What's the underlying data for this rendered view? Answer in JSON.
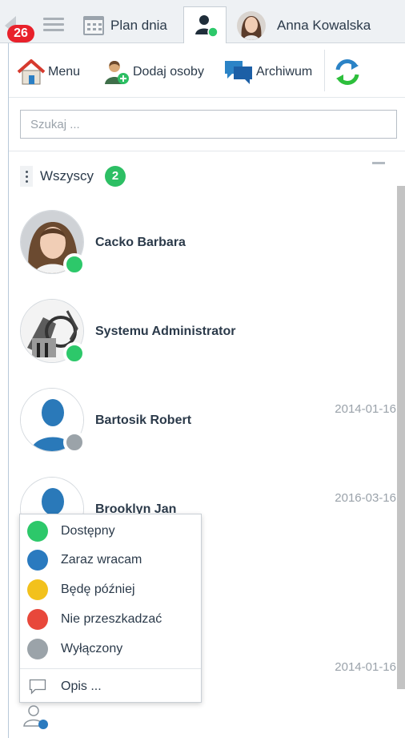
{
  "tabs": {
    "badge_count": "26",
    "plan_label": "Plan dnia",
    "user_name": "Anna Kowalska"
  },
  "toolbar": {
    "menu_label": "Menu",
    "add_people_label": "Dodaj osoby",
    "archive_label": "Archiwum"
  },
  "search": {
    "value": "",
    "placeholder": "Szukaj ..."
  },
  "group": {
    "name": "Wszyscy",
    "count": "2"
  },
  "contacts": [
    {
      "name": "Cacko Barbara",
      "date": "",
      "status": "available",
      "avatar": "photo-woman"
    },
    {
      "name": "Systemu Administrator",
      "date": "",
      "status": "available",
      "avatar": "machine"
    },
    {
      "name": "Bartosik Robert",
      "date": "2014-01-16",
      "status": "offline",
      "avatar": "silhouette"
    },
    {
      "name": "Brooklyn Jan",
      "date": "2016-03-16",
      "status": "offline",
      "avatar": "silhouette"
    },
    {
      "name": "",
      "date": "2014-01-16",
      "status": "offline",
      "avatar": "silhouette"
    }
  ],
  "status_menu": {
    "items": [
      {
        "label": "Dostępny",
        "color": "#2dc86a"
      },
      {
        "label": "Zaraz wracam",
        "color": "#2a7abf"
      },
      {
        "label": "Będę później",
        "color": "#f2c11c"
      },
      {
        "label": "Nie przeszkadzać",
        "color": "#e8483b"
      },
      {
        "label": "Wyłączony",
        "color": "#9ba3a9"
      }
    ],
    "description_label": "Opis ..."
  },
  "colors": {
    "available": "#2dc86a",
    "offline": "#9ba3a9",
    "accent_blue": "#2b83c6",
    "badge_red": "#e8212b"
  }
}
